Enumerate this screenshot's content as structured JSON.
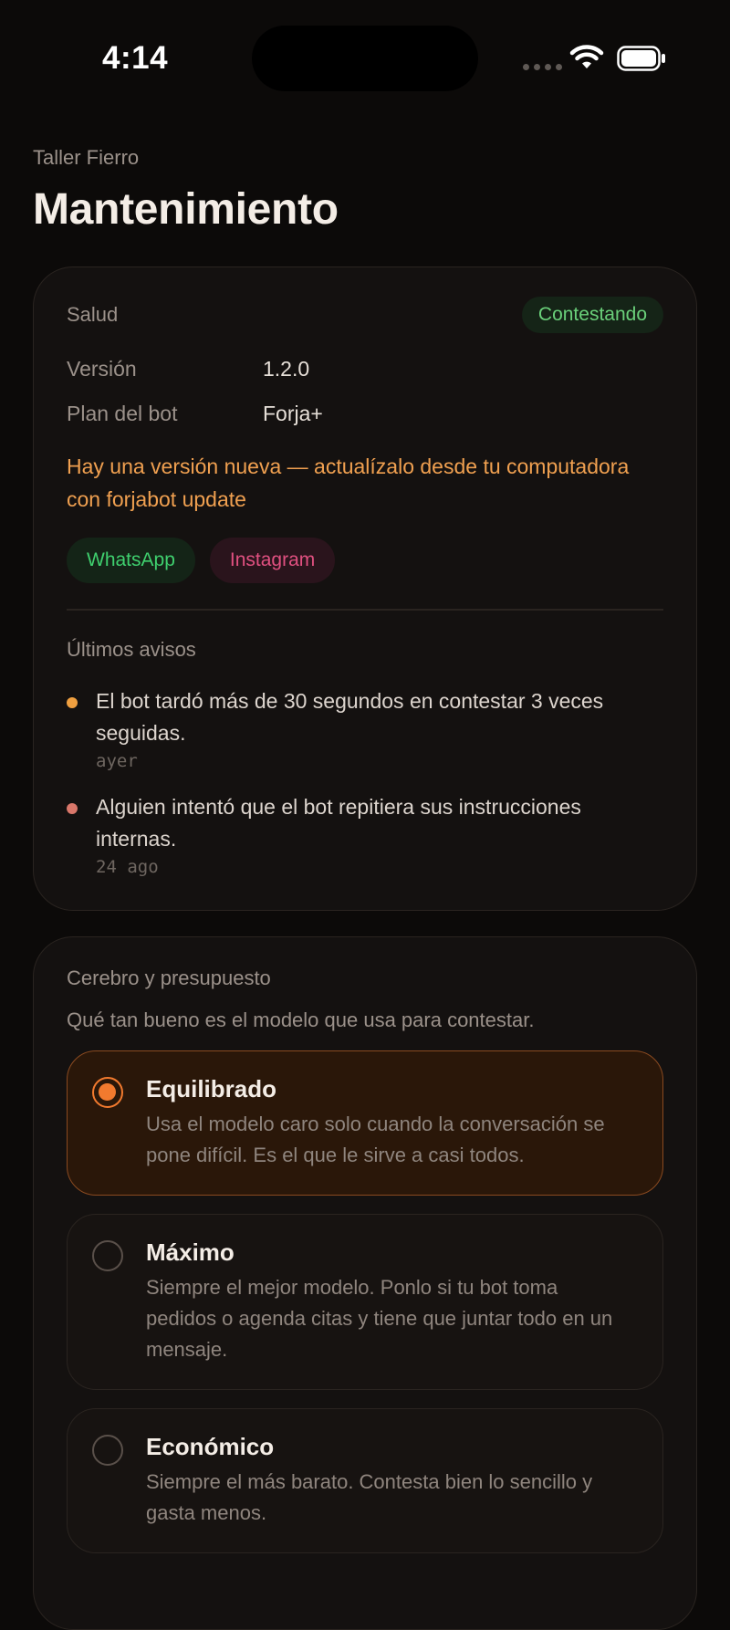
{
  "status_bar": {
    "time": "4:14"
  },
  "header": {
    "org": "Taller Fierro",
    "title": "Mantenimiento"
  },
  "health": {
    "label": "Salud",
    "status": "Contestando",
    "status_color": "#6ad07a",
    "version_label": "Versión",
    "version": "1.2.0",
    "plan_label": "Plan del bot",
    "plan": "Forja+",
    "update_note": "Hay una versión nueva — actualízalo desde tu computadora con forjabot update",
    "channels": [
      {
        "label": "WhatsApp",
        "color": "#3fcf6e"
      },
      {
        "label": "Instagram",
        "color": "#e05080"
      }
    ],
    "alerts_label": "Últimos avisos",
    "alerts": [
      {
        "text": "El bot tardó más de 30 segundos en contestar 3 veces seguidas.",
        "time": "ayer",
        "color": "#f0a040"
      },
      {
        "text": "Alguien intentó que el bot repitiera sus instrucciones internas.",
        "time": "24 ago",
        "color": "#d9776a"
      }
    ]
  },
  "brain": {
    "title": "Cerebro y presupuesto",
    "subtitle": "Qué tan bueno es el modelo que usa para contestar.",
    "accent": "#f27a2e",
    "options": [
      {
        "title": "Equilibrado",
        "desc": "Usa el modelo caro solo cuando la conversación se pone difícil. Es el que le sirve a casi todos.",
        "selected": true
      },
      {
        "title": "Máximo",
        "desc": "Siempre el mejor modelo. Ponlo si tu bot toma pedidos o agenda citas y tiene que juntar todo en un mensaje.",
        "selected": false
      },
      {
        "title": "Económico",
        "desc": "Siempre el más barato. Contesta bien lo sencillo y gasta menos.",
        "selected": false
      }
    ]
  }
}
